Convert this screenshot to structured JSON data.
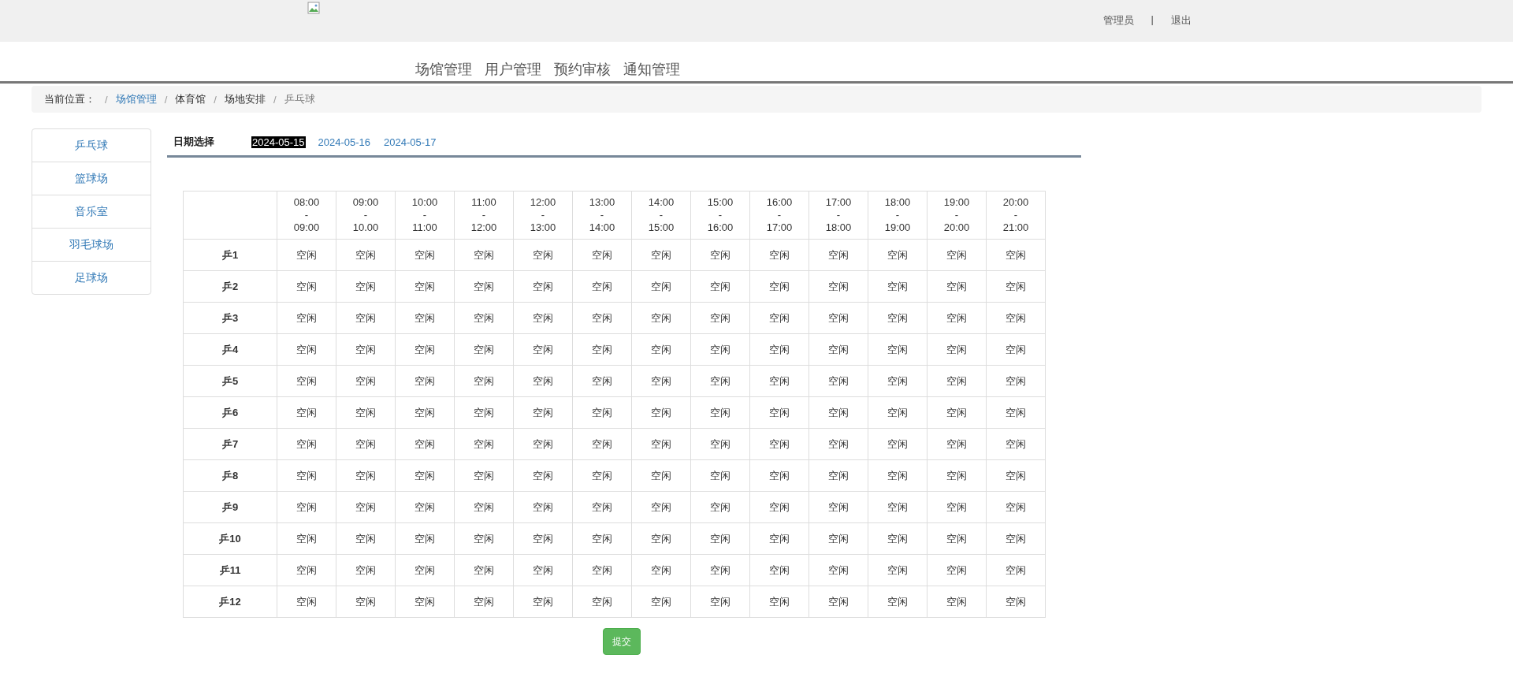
{
  "header": {
    "user": "管理员",
    "separator": "|",
    "logout": "退出"
  },
  "nav": [
    "场馆管理",
    "用户管理",
    "预约审核",
    "通知管理"
  ],
  "breadcrumb": {
    "label": "当前位置：",
    "items": [
      {
        "text": "场馆管理",
        "link": true
      },
      {
        "text": "体育馆",
        "link": false
      },
      {
        "text": "场地安排",
        "link": false
      },
      {
        "text": "乒乓球",
        "link": false
      }
    ],
    "divider": "/"
  },
  "sidebar": {
    "items": [
      "乒乓球",
      "篮球场",
      "音乐室",
      "羽毛球场",
      "足球场"
    ]
  },
  "date_picker": {
    "label": "日期选择",
    "dates": [
      {
        "text": "2024-05-15",
        "selected": true
      },
      {
        "text": "2024-05-16",
        "selected": false
      },
      {
        "text": "2024-05-17",
        "selected": false
      }
    ]
  },
  "table": {
    "columns": [
      "08:00\n-\n09:00",
      "09:00\n-\n10.00",
      "10:00\n-\n11:00",
      "11:00\n-\n12:00",
      "12:00\n-\n13:00",
      "13:00\n-\n14:00",
      "14:00\n-\n15:00",
      "15:00\n-\n16:00",
      "16:00\n-\n17:00",
      "17:00\n-\n18:00",
      "18:00\n-\n19:00",
      "19:00\n-\n20:00",
      "20:00\n-\n21:00"
    ],
    "rows": [
      {
        "name": "乒1",
        "cells": [
          "空闲",
          "空闲",
          "空闲",
          "空闲",
          "空闲",
          "空闲",
          "空闲",
          "空闲",
          "空闲",
          "空闲",
          "空闲",
          "空闲",
          "空闲"
        ]
      },
      {
        "name": "乒2",
        "cells": [
          "空闲",
          "空闲",
          "空闲",
          "空闲",
          "空闲",
          "空闲",
          "空闲",
          "空闲",
          "空闲",
          "空闲",
          "空闲",
          "空闲",
          "空闲"
        ]
      },
      {
        "name": "乒3",
        "cells": [
          "空闲",
          "空闲",
          "空闲",
          "空闲",
          "空闲",
          "空闲",
          "空闲",
          "空闲",
          "空闲",
          "空闲",
          "空闲",
          "空闲",
          "空闲"
        ]
      },
      {
        "name": "乒4",
        "cells": [
          "空闲",
          "空闲",
          "空闲",
          "空闲",
          "空闲",
          "空闲",
          "空闲",
          "空闲",
          "空闲",
          "空闲",
          "空闲",
          "空闲",
          "空闲"
        ]
      },
      {
        "name": "乒5",
        "cells": [
          "空闲",
          "空闲",
          "空闲",
          "空闲",
          "空闲",
          "空闲",
          "空闲",
          "空闲",
          "空闲",
          "空闲",
          "空闲",
          "空闲",
          "空闲"
        ]
      },
      {
        "name": "乒6",
        "cells": [
          "空闲",
          "空闲",
          "空闲",
          "空闲",
          "空闲",
          "空闲",
          "空闲",
          "空闲",
          "空闲",
          "空闲",
          "空闲",
          "空闲",
          "空闲"
        ]
      },
      {
        "name": "乒7",
        "cells": [
          "空闲",
          "空闲",
          "空闲",
          "空闲",
          "空闲",
          "空闲",
          "空闲",
          "空闲",
          "空闲",
          "空闲",
          "空闲",
          "空闲",
          "空闲"
        ]
      },
      {
        "name": "乒8",
        "cells": [
          "空闲",
          "空闲",
          "空闲",
          "空闲",
          "空闲",
          "空闲",
          "空闲",
          "空闲",
          "空闲",
          "空闲",
          "空闲",
          "空闲",
          "空闲"
        ]
      },
      {
        "name": "乒9",
        "cells": [
          "空闲",
          "空闲",
          "空闲",
          "空闲",
          "空闲",
          "空闲",
          "空闲",
          "空闲",
          "空闲",
          "空闲",
          "空闲",
          "空闲",
          "空闲"
        ]
      },
      {
        "name": "乒10",
        "cells": [
          "空闲",
          "空闲",
          "空闲",
          "空闲",
          "空闲",
          "空闲",
          "空闲",
          "空闲",
          "空闲",
          "空闲",
          "空闲",
          "空闲",
          "空闲"
        ]
      },
      {
        "name": "乒11",
        "cells": [
          "空闲",
          "空闲",
          "空闲",
          "空闲",
          "空闲",
          "空闲",
          "空闲",
          "空闲",
          "空闲",
          "空闲",
          "空闲",
          "空闲",
          "空闲"
        ]
      },
      {
        "name": "乒12",
        "cells": [
          "空闲",
          "空闲",
          "空闲",
          "空闲",
          "空闲",
          "空闲",
          "空闲",
          "空闲",
          "空闲",
          "空闲",
          "空闲",
          "空闲",
          "空闲"
        ]
      }
    ]
  },
  "submit_button": "提交"
}
